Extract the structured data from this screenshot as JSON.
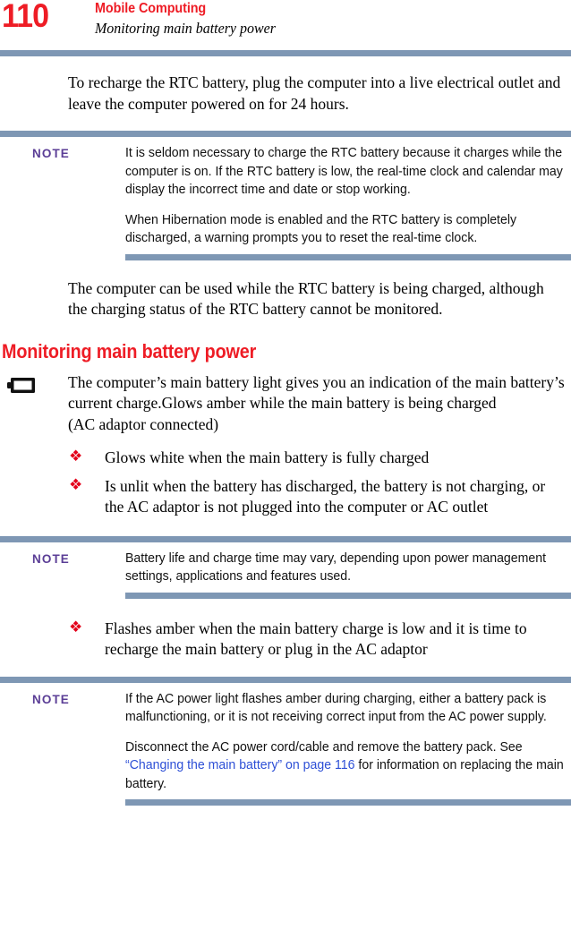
{
  "header": {
    "page_number": "110",
    "chapter_title": "Mobile Computing",
    "section_subtitle": "Monitoring main battery power",
    "title_color": "#ee1c25",
    "rule_color": "#7e97b4"
  },
  "intro_paragraph": "To recharge the RTC battery, plug the computer into a live electrical outlet and leave the computer powered on for 24 hours.",
  "note_1": {
    "label": "NOTE",
    "label_color": "#5b3e96",
    "paragraphs": [
      "It is seldom necessary to charge the RTC battery because it charges while the computer is on. If the RTC battery is low, the real-time clock and calendar may display the incorrect time and date or stop working.",
      "When Hibernation mode is enabled and the RTC battery is completely discharged, a warning prompts you to reset the real-time clock."
    ]
  },
  "after_note_paragraph": "The computer can be used while the RTC battery is being charged, although the charging status of the RTC battery cannot be monitored.",
  "section_heading": "Monitoring main battery power",
  "battery_icon_name": "battery-icon",
  "battery_paragraph": "The computer’s main battery light gives you an indication of the main battery’s current charge.Glows amber while the main battery is being charged\n(AC adaptor connected)",
  "bullets_group_1": [
    "Glows white when the main battery is fully charged",
    "Is unlit when the battery has discharged, the battery is not charging, or the AC adaptor is not plugged into the computer or AC outlet"
  ],
  "note_2": {
    "label": "NOTE",
    "paragraphs": [
      "Battery life and charge time may vary, depending upon power management settings, applications and features used."
    ]
  },
  "bullets_group_2": [
    "Flashes amber when the main battery charge is low and it is time to recharge the main battery or plug in the AC adaptor"
  ],
  "note_3": {
    "label": "NOTE",
    "paragraph_1": "If the AC power light flashes amber during charging, either a battery pack is malfunctioning, or it is not receiving correct input from the AC power supply.",
    "paragraph_2_before": "Disconnect the AC power cord/cable and remove the battery pack. See ",
    "paragraph_2_link": "“Changing the main battery” on page 116",
    "paragraph_2_after": " for information on replacing the main battery.",
    "link_color": "#2d4fd6"
  },
  "bullet_glyph": "❖"
}
